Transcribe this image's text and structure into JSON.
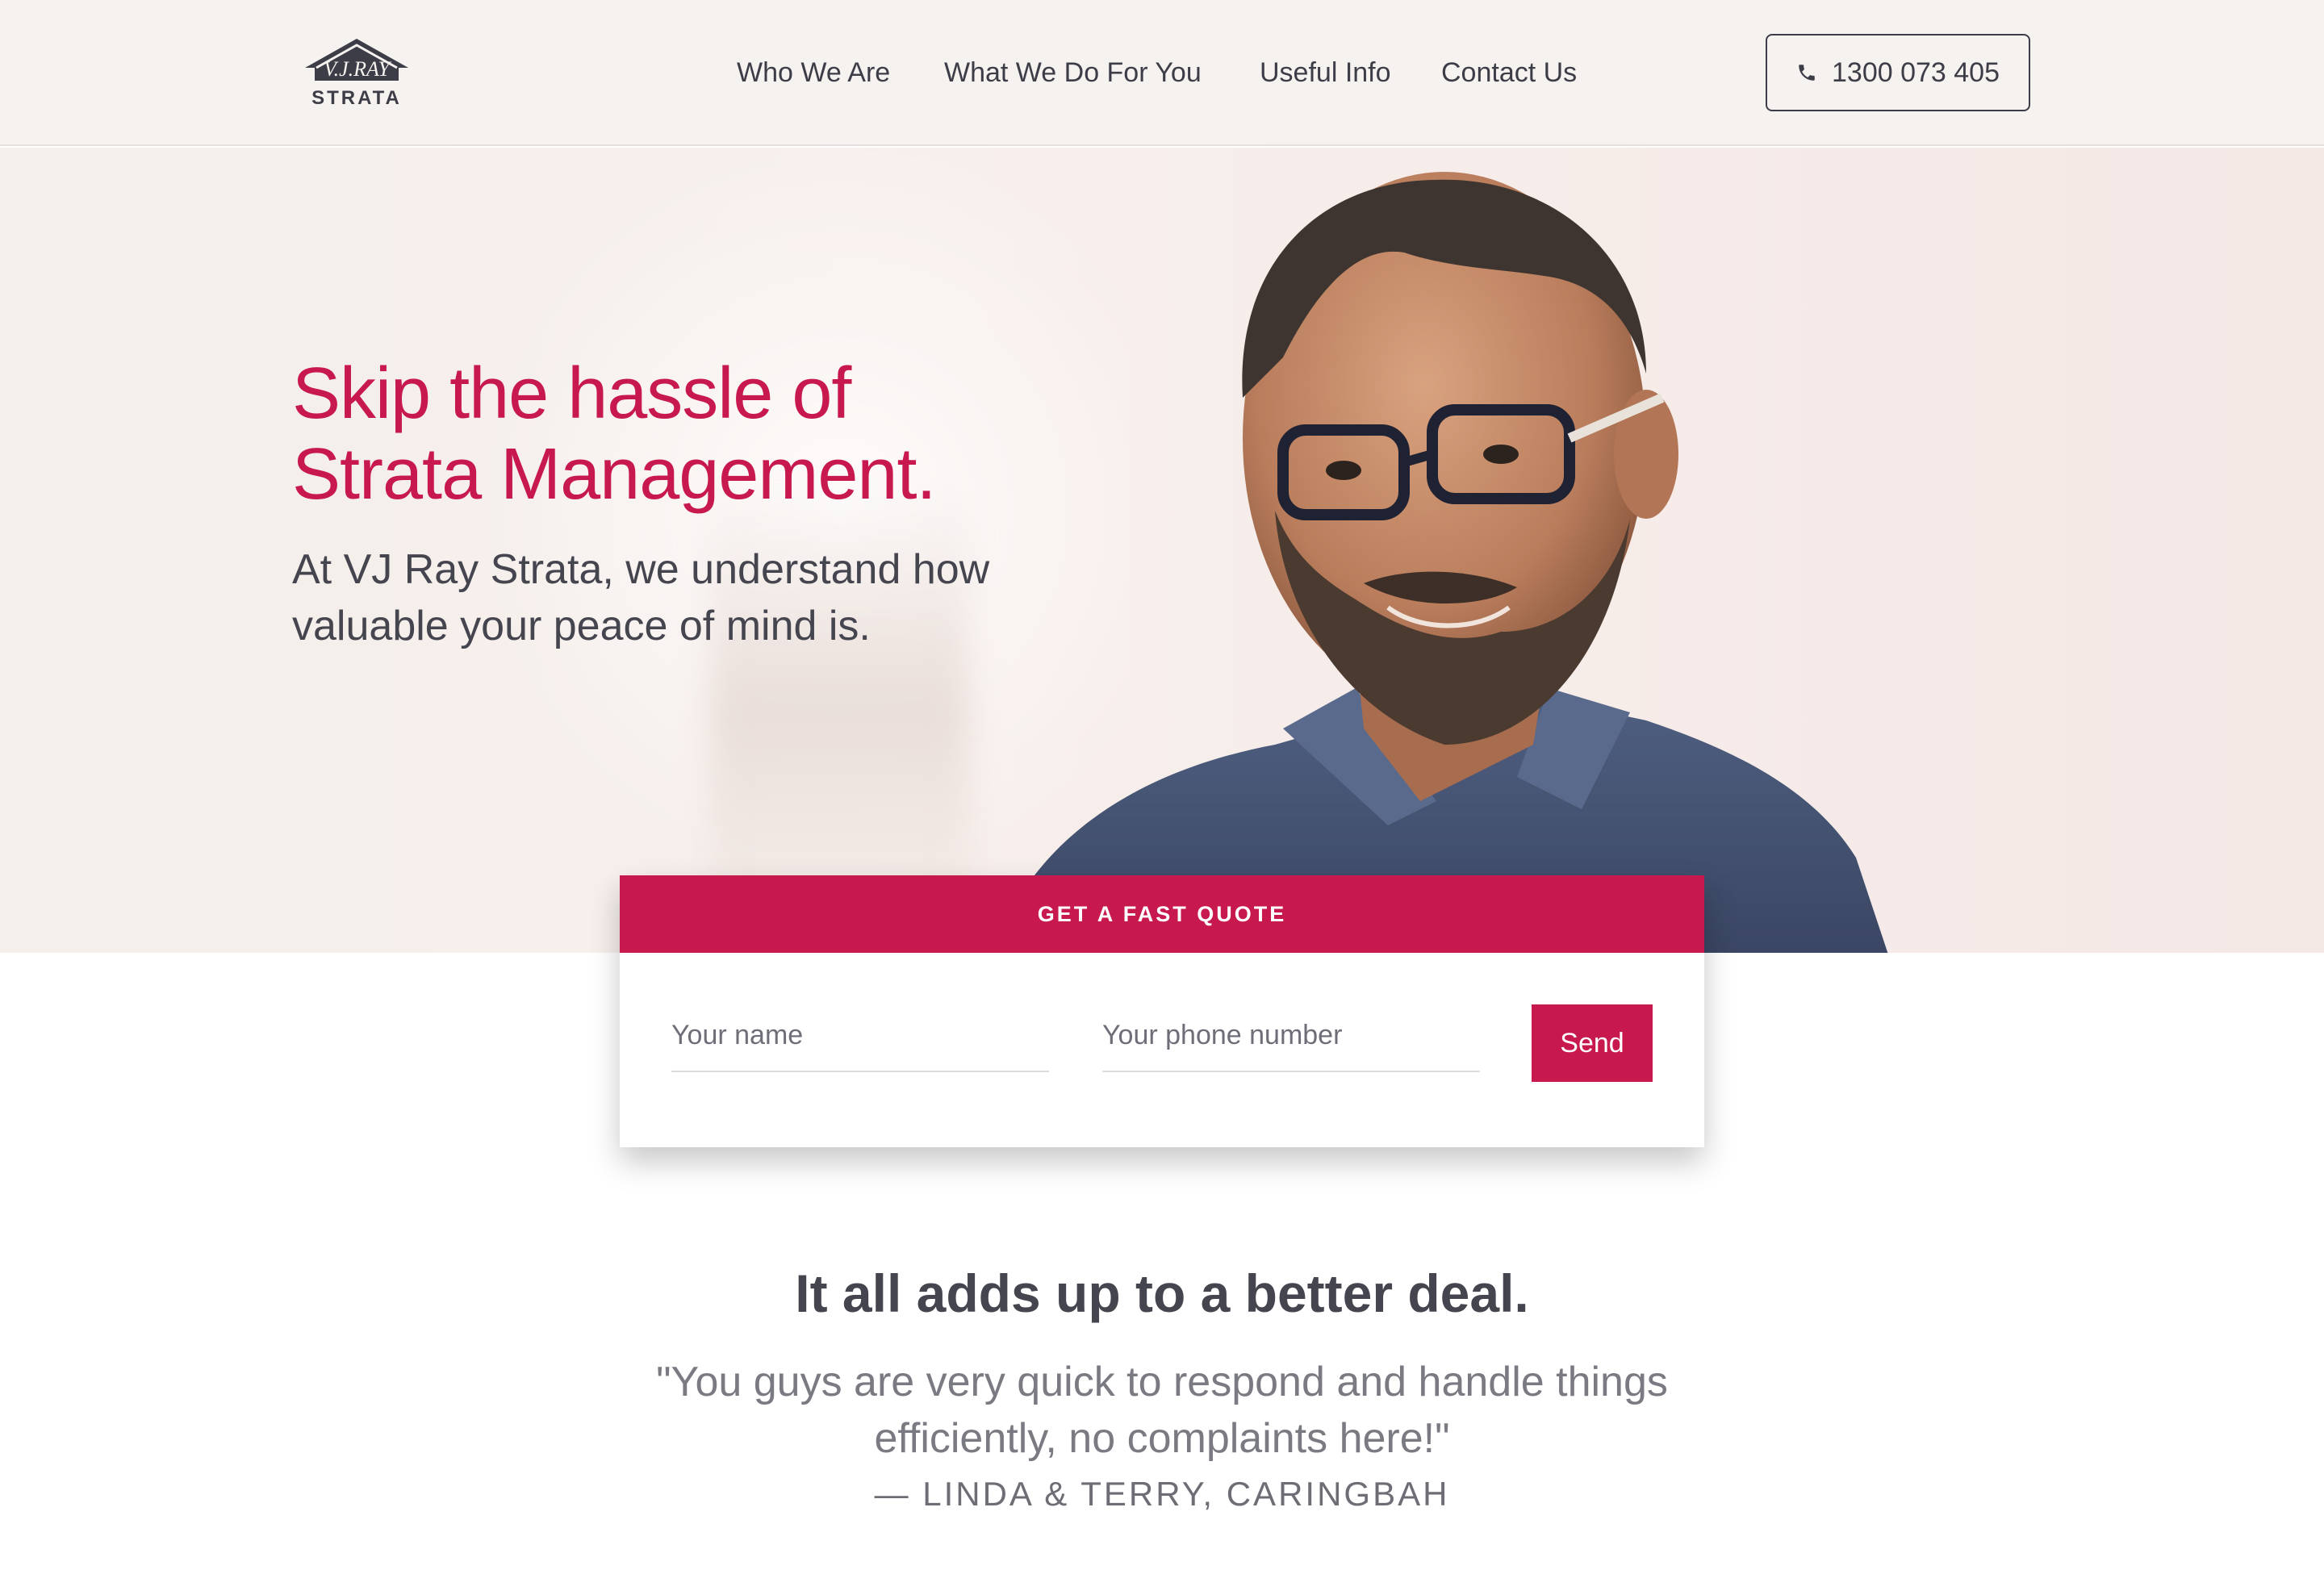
{
  "brand": {
    "logo_text": "V.J.RAY",
    "logo_subtext": "STRATA"
  },
  "nav": {
    "items": [
      {
        "label": "Who We Are"
      },
      {
        "label": "What We Do For You"
      },
      {
        "label": "Useful Info"
      },
      {
        "label": "Contact Us"
      }
    ],
    "phone_label": "1300 073 405"
  },
  "hero": {
    "title_line1": "Skip the hassle of",
    "title_line2": "Strata Management.",
    "subtitle_line1": "At VJ Ray Strata, we understand how",
    "subtitle_line2": "valuable your peace of mind is."
  },
  "quote_form": {
    "heading": "GET A FAST QUOTE",
    "name_placeholder": "Your name",
    "phone_placeholder": "Your phone number",
    "send_label": "Send"
  },
  "testimonial": {
    "heading": "It all adds up to a better deal.",
    "quote_line1": "\"You guys are very quick to respond and handle things",
    "quote_line2": "efficiently, no complaints here!\"",
    "author": "— LINDA & TERRY, CARINGBAH"
  },
  "colors": {
    "accent": "#c8194e",
    "text_dark": "#3d3d48",
    "header_bg": "#f6f2ef"
  }
}
